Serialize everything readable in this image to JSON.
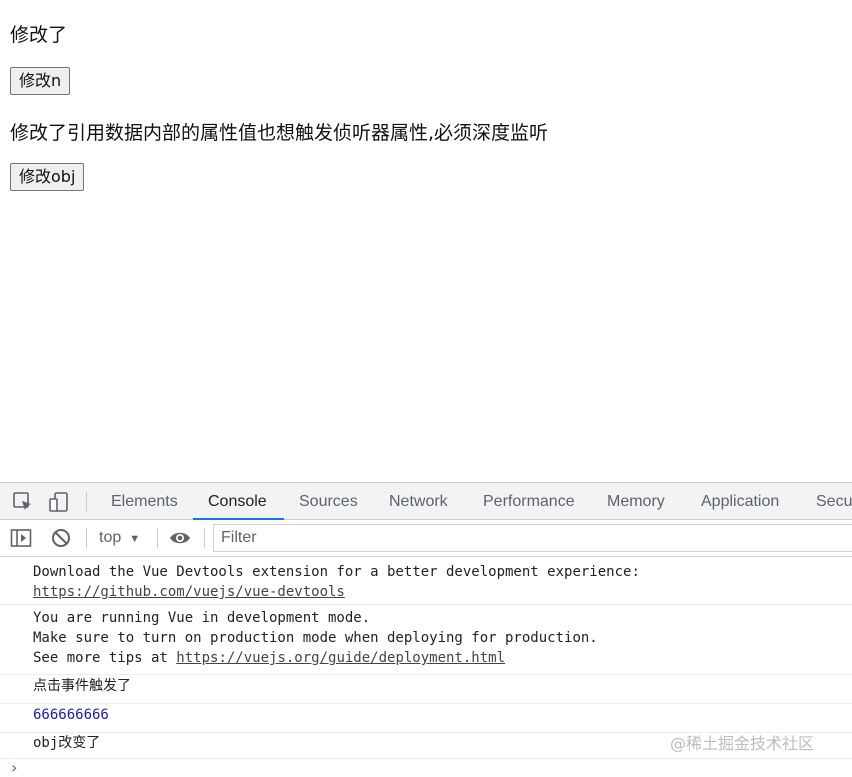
{
  "page": {
    "text1": "修改了",
    "btn1": "修改n",
    "text2": "修改了引用数据内部的属性值也想触发侦听器属性,必须深度监听",
    "btn2": "修改obj"
  },
  "devtools": {
    "tabs": [
      "Elements",
      "Console",
      "Sources",
      "Network",
      "Performance",
      "Memory",
      "Application",
      "Secu"
    ],
    "active_tab": "Console",
    "context": "top",
    "filter_placeholder": "Filter",
    "icons": [
      "inspect-icon",
      "device-toggle-icon",
      "sidebar-toggle-icon",
      "clear-console-icon",
      "eye-icon",
      "context-dropdown-icon",
      "prompt-chevron-icon"
    ],
    "accent_color": "#1a73e8"
  },
  "console": {
    "m1": {
      "line1": "Download the Vue Devtools extension for a better development experience:",
      "link": "https://github.com/vuejs/vue-devtools"
    },
    "m2": {
      "line1": "You are running Vue in development mode.",
      "line2": "Make sure to turn on production mode when deploying for production.",
      "line3_prefix": "See more tips at ",
      "link": "https://vuejs.org/guide/deployment.html"
    },
    "m3": "点击事件触发了",
    "m4": "666666666",
    "m5": "obj改变了"
  },
  "watermark": "@稀土掘金技术社区"
}
